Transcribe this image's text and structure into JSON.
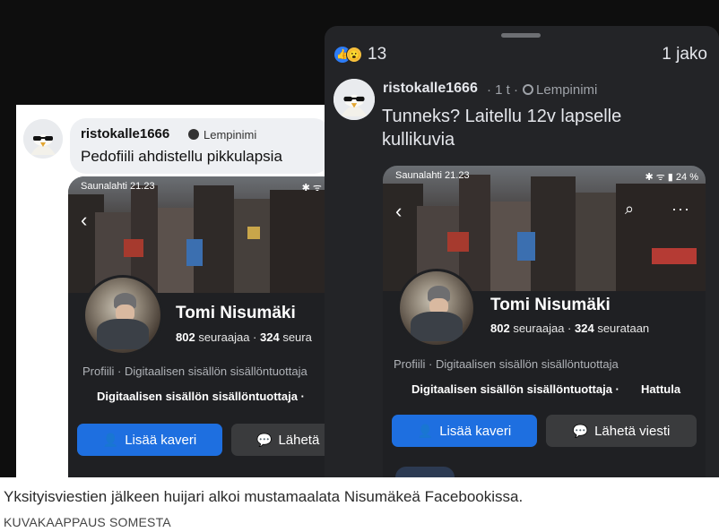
{
  "left_comment": {
    "username": "ristokalle1666",
    "badge": "Lempinimi",
    "text": "Pedofiili ahdistellu pikkulapsia"
  },
  "left_profile": {
    "status_left": "Saunalahti 21.23",
    "status_right": "✱ ᯤ ▮",
    "name": "Tomi Nisumäki",
    "followers_count": "802",
    "followers_label": "seuraajaa",
    "following_count": "324",
    "following_label": "seura",
    "role_line": "Profiili · Digitaalisen sisällön sisällöntuottaja",
    "category": "Digitaalisen sisällön sisällöntuottaja ·",
    "add_friend": "Lisää kaveri",
    "message": "Lähetä"
  },
  "right_post": {
    "reaction_count": "13",
    "share_count": "1 jako",
    "username": "ristokalle1666",
    "time": "· 1 t ·",
    "badge": "Lempinimi",
    "text": "Tunneks?  Laitellu 12v lapselle kullikuvia"
  },
  "right_profile": {
    "status_left": "Saunalahti 21.23",
    "status_right": "✱ ᯤ ▮ 24 %",
    "name": "Tomi Nisumäki",
    "followers_count": "802",
    "followers_label": "seuraajaa",
    "following_count": "324",
    "following_label": "seurataan",
    "role_line": "Profiili · Digitaalisen sisällön sisällöntuottaja",
    "category": "Digitaalisen sisällön sisällöntuottaja ·",
    "location": "Hattula",
    "add_friend": "Lisää kaveri",
    "message": "Lähetä viesti"
  },
  "caption": "Yksityisviestien jälkeen huijari alkoi mustamaalata Nisumäkeä Facebookissa.",
  "credit": "KUVAKAAPPAUS SOMESTA",
  "colors": {
    "fb_blue": "#1e6fe0",
    "dark_bg": "#232427",
    "light_bubble": "#eef0f3"
  }
}
